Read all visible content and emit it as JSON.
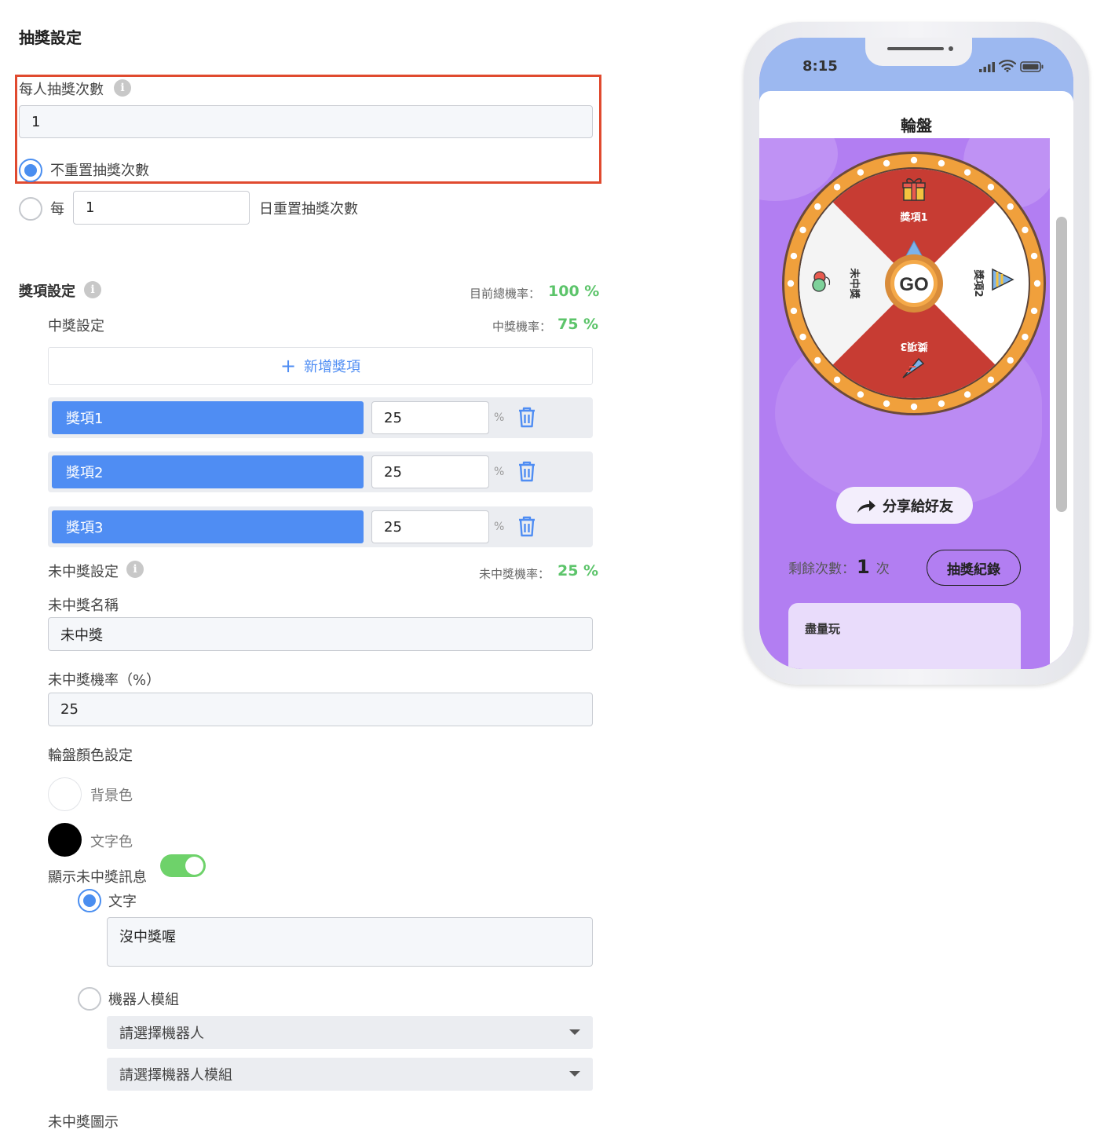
{
  "settings": {
    "section_title": "抽獎設定",
    "draws_per_person_label": "每人抽獎次數",
    "draws_per_person_value": "1",
    "no_reset_label": "不重置抽獎次數",
    "reset_every_prefix": "每",
    "reset_every_value": "1",
    "reset_every_suffix": "日重置抽獎次數"
  },
  "prizes": {
    "section_title": "獎項設定",
    "total_rate_label": "目前總機率：",
    "total_rate_value": "100 %",
    "win_settings_label": "中獎設定",
    "win_rate_label": "中獎機率：",
    "win_rate_value": "75 %",
    "add_prize_label": "新增獎項",
    "items": [
      {
        "name": "獎項1",
        "percent": "25"
      },
      {
        "name": "獎項2",
        "percent": "25"
      },
      {
        "name": "獎項3",
        "percent": "25"
      }
    ],
    "percent_sign": "%"
  },
  "lose": {
    "settings_label": "未中獎設定",
    "rate_label": "未中獎機率：",
    "rate_value": "25 %",
    "name_label": "未中獎名稱",
    "name_value": "未中獎",
    "probability_label": "未中獎機率（%）",
    "probability_value": "25",
    "wheel_color_label": "輪盤顏色設定",
    "bg_color_label": "背景色",
    "text_color_label": "文字色",
    "show_message_label": "顯示未中獎訊息",
    "show_message_on": true,
    "text_option_label": "文字",
    "text_message_value": "沒中獎喔",
    "bot_option_label": "機器人模組",
    "select_bot_placeholder": "請選擇機器人",
    "select_bot_module_placeholder": "請選擇機器人模組",
    "icon_label": "未中獎圖示"
  },
  "phone": {
    "time": "8:15",
    "page_title": "輪盤",
    "go_label": "GO",
    "wheel_labels": [
      "獎項1",
      "獎項2",
      "獎項3",
      "未中獎"
    ],
    "share_label": "分享給好友",
    "remaining_label": "剩餘次數：",
    "remaining_value": "1",
    "remaining_unit": "次",
    "history_label": "抽獎紀錄",
    "notice_text": "盡量玩"
  },
  "colors": {
    "accent_blue": "#4f8df3",
    "green": "#5cc46a",
    "highlight_red": "#e04a2f",
    "wheel_red": "#c73c33",
    "wheel_orange": "#f0a03c",
    "phone_purple": "#b27ef2"
  }
}
